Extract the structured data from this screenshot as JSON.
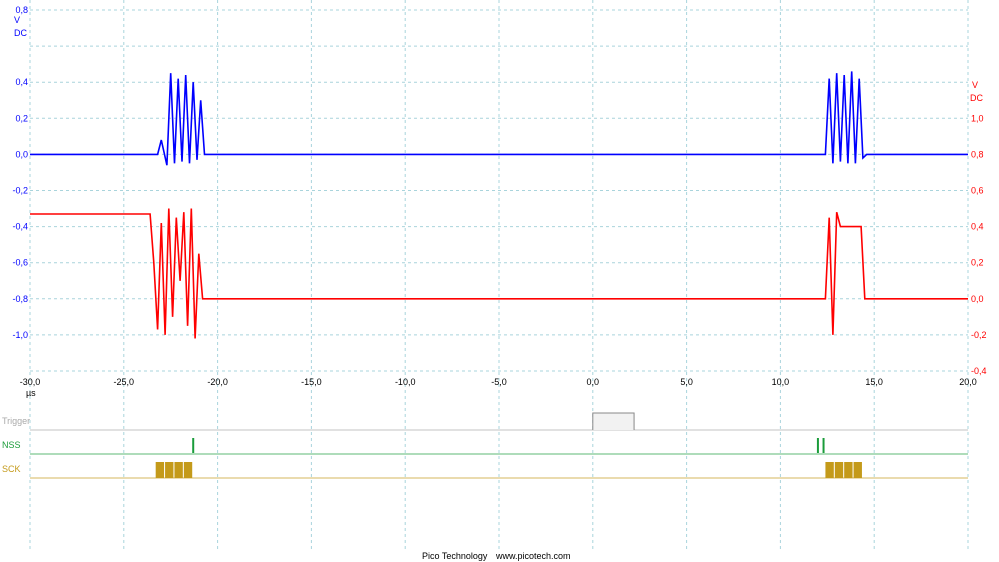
{
  "chart_data": {
    "type": "line",
    "x_unit_label": "µs",
    "x_ticks": [
      "-30,0",
      "-25,0",
      "-20,0",
      "-15,0",
      "-10,0",
      "-5,0",
      "0,0",
      "5,0",
      "10,0",
      "15,0",
      "20,0"
    ],
    "xlim": [
      -30,
      20
    ],
    "axis_left": {
      "unit": "V",
      "coupling": "DC",
      "color": "#0000ff",
      "ylim": [
        -1.2,
        0.8
      ],
      "ticks": [
        "0,8",
        "0,4",
        "0,2",
        "0,0",
        "-0,2",
        "-0,4",
        "-0,6",
        "-0,8",
        "-1,0"
      ],
      "tick_values": [
        0.8,
        0.4,
        0.2,
        0.0,
        -0.2,
        -0.4,
        -0.6,
        -0.8,
        -1.0
      ]
    },
    "axis_right": {
      "unit": "V",
      "coupling": "DC",
      "color": "#ff0000",
      "ylim": [
        -0.4,
        1.6
      ],
      "ticks": [
        "1,0",
        "0,8",
        "0,6",
        "0,4",
        "0,2",
        "0,0",
        "-0,2",
        "-0,4"
      ],
      "tick_values": [
        1.0,
        0.8,
        0.6,
        0.4,
        0.2,
        0.0,
        -0.2,
        -0.4
      ]
    },
    "grid": true,
    "series": [
      {
        "axis": "left",
        "color": "#0000ff",
        "x": [
          -30,
          -23.2,
          -23.0,
          -22.7,
          -22.5,
          -22.3,
          -22.1,
          -21.9,
          -21.7,
          -21.5,
          -21.3,
          -21.1,
          -20.9,
          -20.7,
          12.4,
          12.6,
          12.8,
          13.0,
          13.2,
          13.4,
          13.6,
          13.8,
          14.0,
          14.2,
          14.4,
          14.6,
          20
        ],
        "y": [
          0.0,
          0.0,
          0.08,
          -0.06,
          0.45,
          -0.05,
          0.42,
          -0.04,
          0.44,
          -0.05,
          0.4,
          -0.03,
          0.3,
          0.0,
          0.0,
          0.42,
          -0.05,
          0.45,
          -0.04,
          0.44,
          -0.05,
          0.46,
          -0.05,
          0.42,
          -0.02,
          0.0,
          0.0
        ]
      },
      {
        "axis": "right",
        "color": "#ff0000",
        "x": [
          -30,
          -23.6,
          -23.4,
          -23.2,
          -23.0,
          -22.8,
          -22.6,
          -22.4,
          -22.2,
          -22.0,
          -21.8,
          -21.6,
          -21.4,
          -21.2,
          -21.0,
          -20.8,
          12.4,
          12.6,
          12.8,
          13.0,
          13.2,
          14.3,
          14.5,
          14.7,
          20
        ],
        "y": [
          0.47,
          0.47,
          0.2,
          -0.17,
          0.42,
          -0.2,
          0.5,
          -0.1,
          0.45,
          0.1,
          0.48,
          -0.15,
          0.5,
          -0.22,
          0.25,
          0.0,
          0.0,
          0.45,
          -0.2,
          0.48,
          0.4,
          0.4,
          0.0,
          0.0,
          0.0
        ]
      }
    ],
    "digital": [
      {
        "name": "Trigger",
        "color": "#aaaaaa"
      },
      {
        "name": "NSS",
        "color": "#1a9c3a",
        "pulses_us": [
          -21.3,
          12.0,
          12.3
        ]
      },
      {
        "name": "SCK",
        "color": "#c49a1a",
        "bursts_us": [
          [
            -23.3,
            -21.3
          ],
          [
            12.4,
            14.4
          ]
        ]
      }
    ]
  },
  "footer": {
    "company": "Pico Technology",
    "url": "www.picotech.com"
  }
}
